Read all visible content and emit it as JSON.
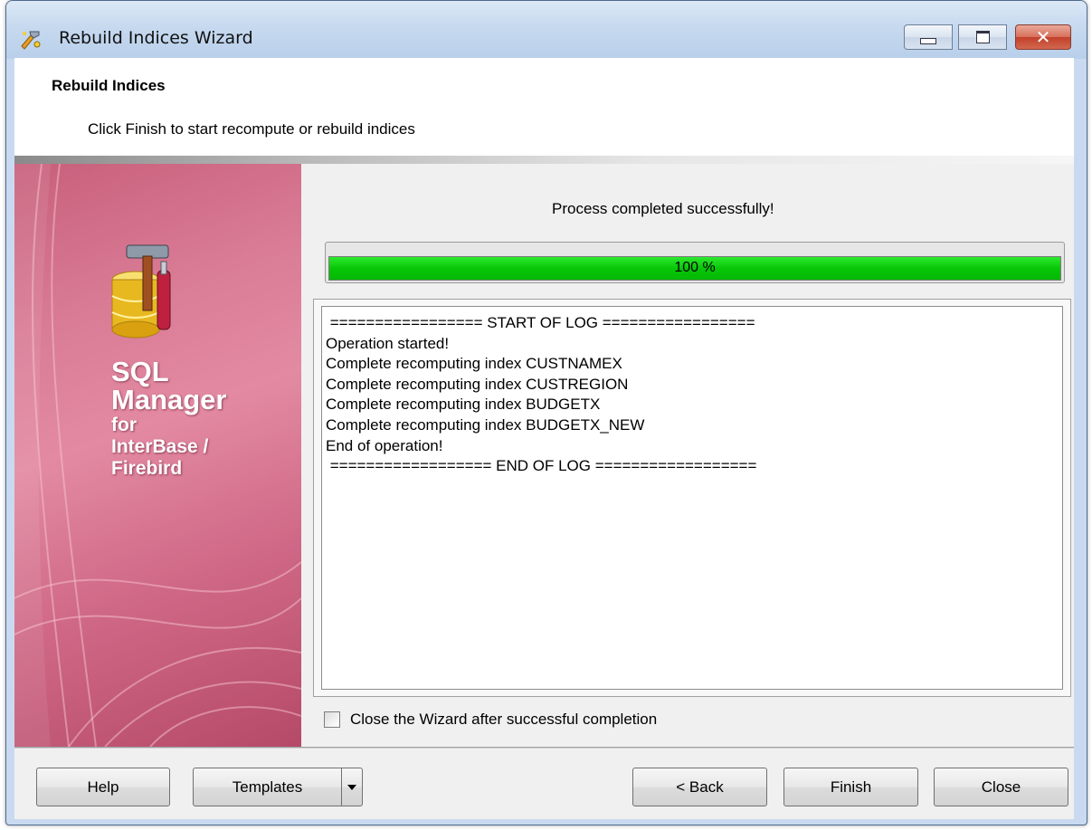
{
  "window": {
    "title": "Rebuild Indices Wizard"
  },
  "header": {
    "title": "Rebuild Indices",
    "subtitle": "Click Finish to start recompute or rebuild indices"
  },
  "banner": {
    "line1": "SQL",
    "line2": "Manager",
    "line3": "for",
    "line4": "InterBase /",
    "line5": "Firebird"
  },
  "status": {
    "message": "Process completed successfully!",
    "progress_percent": 100,
    "progress_label": "100 %",
    "progress_color": "#07c707"
  },
  "log": {
    "lines": [
      " ================= START OF LOG =================",
      "Operation started!",
      "Complete recomputing index CUSTNAMEX",
      "Complete recomputing index CUSTREGION",
      "Complete recomputing index BUDGETX",
      "Complete recomputing index BUDGETX_NEW",
      "End of operation!",
      " ================== END OF LOG =================="
    ]
  },
  "options": {
    "close_after_label": "Close the Wizard after successful completion",
    "close_after_checked": false
  },
  "buttons": {
    "help": "Help",
    "templates": "Templates",
    "back": "< Back",
    "finish": "Finish",
    "close": "Close"
  }
}
